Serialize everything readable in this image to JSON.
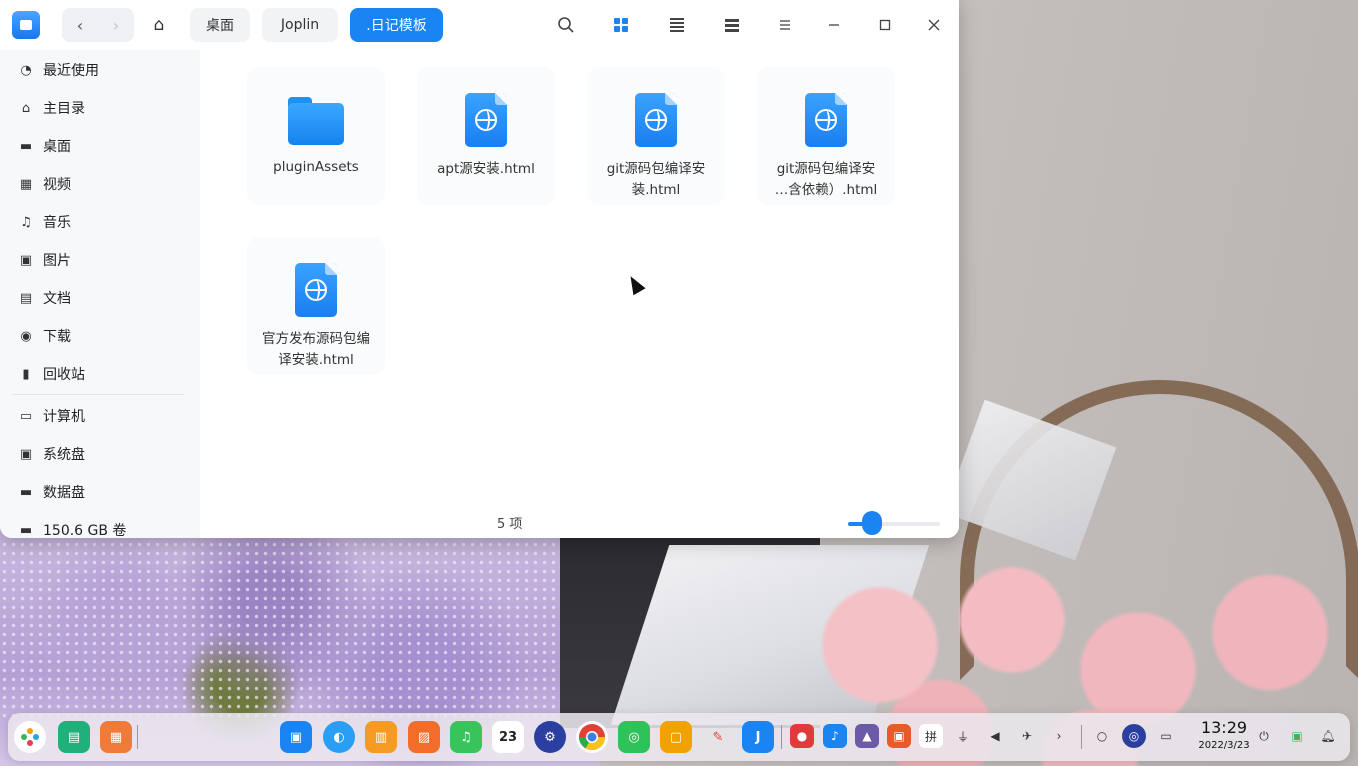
{
  "window": {
    "nav": {
      "back": "‹",
      "forward": "›"
    },
    "breadcrumbs": [
      "桌面",
      "Joplin",
      ".日记模板"
    ],
    "active_crumb": ".日记模板"
  },
  "sidebar": {
    "items": [
      {
        "label": "最近使用",
        "icon": "clock-icon"
      },
      {
        "label": "主目录",
        "icon": "home-icon"
      },
      {
        "label": "桌面",
        "icon": "desktop-icon"
      },
      {
        "label": "视频",
        "icon": "video-icon"
      },
      {
        "label": "音乐",
        "icon": "music-icon"
      },
      {
        "label": "图片",
        "icon": "picture-icon"
      },
      {
        "label": "文档",
        "icon": "document-icon"
      },
      {
        "label": "下载",
        "icon": "download-icon"
      },
      {
        "label": "回收站",
        "icon": "trash-icon"
      }
    ],
    "devices": [
      {
        "label": "计算机",
        "icon": "computer-icon"
      },
      {
        "label": "系统盘",
        "icon": "drive-icon"
      },
      {
        "label": "数据盘",
        "icon": "drive-icon"
      },
      {
        "label": "150.6 GB 卷",
        "icon": "drive-icon"
      }
    ]
  },
  "files": [
    {
      "name": "pluginAssets",
      "type": "folder"
    },
    {
      "name": "apt源安装.html",
      "type": "html"
    },
    {
      "name_lines": [
        "git源码包编译安",
        "装.html"
      ],
      "type": "html"
    },
    {
      "name_lines": [
        "git源码包编译安",
        "…含依赖）.html"
      ],
      "type": "html"
    },
    {
      "name_lines": [
        "官方发布源码包编",
        "译安装.html"
      ],
      "type": "html"
    }
  ],
  "status": {
    "count": "5 项",
    "zoom_level": 0.2
  },
  "dock": {
    "clock": {
      "time": "13:29",
      "date": "2022/3/23"
    },
    "calendar_day": "23",
    "accent": "#1a84f3"
  }
}
